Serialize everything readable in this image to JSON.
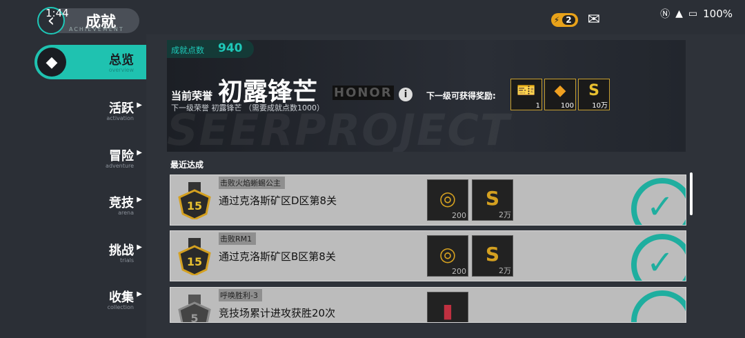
{
  "status": {
    "time": "1:44",
    "battery": "100%"
  },
  "header": {
    "title": "成就",
    "subtitle": "ACHIEVEMENT",
    "energy_count": "2"
  },
  "nav": [
    {
      "label": "总览",
      "sub": "overview"
    },
    {
      "label": "活跃",
      "sub": "activation"
    },
    {
      "label": "冒险",
      "sub": "adventure"
    },
    {
      "label": "竞技",
      "sub": "arena"
    },
    {
      "label": "挑战",
      "sub": "trials"
    },
    {
      "label": "收集",
      "sub": "collection"
    }
  ],
  "banner": {
    "points_label": "成就点数",
    "points_value": "940",
    "honor_label": "当前荣誉",
    "honor_name": "初露锋芒",
    "honor_en": "HONOR",
    "next_line": "下一级荣誉 初露锋芒 （需要成就点数1000）",
    "reward_label": "下一级可获得奖励:",
    "watermark": "SEERPROJECT",
    "rewards": [
      {
        "icon": "ticket-icon",
        "qty": "1"
      },
      {
        "icon": "crystal-icon",
        "qty": "100"
      },
      {
        "icon": "coin-icon",
        "qty": "10万"
      }
    ]
  },
  "recent_label": "最近达成",
  "achievements": [
    {
      "condition": "击败火焰蜥蜴公主",
      "title": "通过克洛斯矿区D区第8关",
      "badge_level": "15",
      "rewards": [
        {
          "icon": "chip-icon",
          "qty": "200"
        },
        {
          "icon": "coin-icon",
          "qty": "2万"
        }
      ]
    },
    {
      "condition": "击败RM1",
      "title": "通过克洛斯矿区B区第8关",
      "badge_level": "15",
      "rewards": [
        {
          "icon": "chip-icon",
          "qty": "200"
        },
        {
          "icon": "coin-icon",
          "qty": "2万"
        }
      ]
    },
    {
      "condition": "呼唤胜利-3",
      "title": "竞技场累计进攻获胜20次",
      "badge_level": "5",
      "rewards": [
        {
          "icon": "card-icon",
          "qty": ""
        }
      ]
    }
  ],
  "colors": {
    "accent": "#1fc2b0",
    "gold": "#c8a030"
  }
}
